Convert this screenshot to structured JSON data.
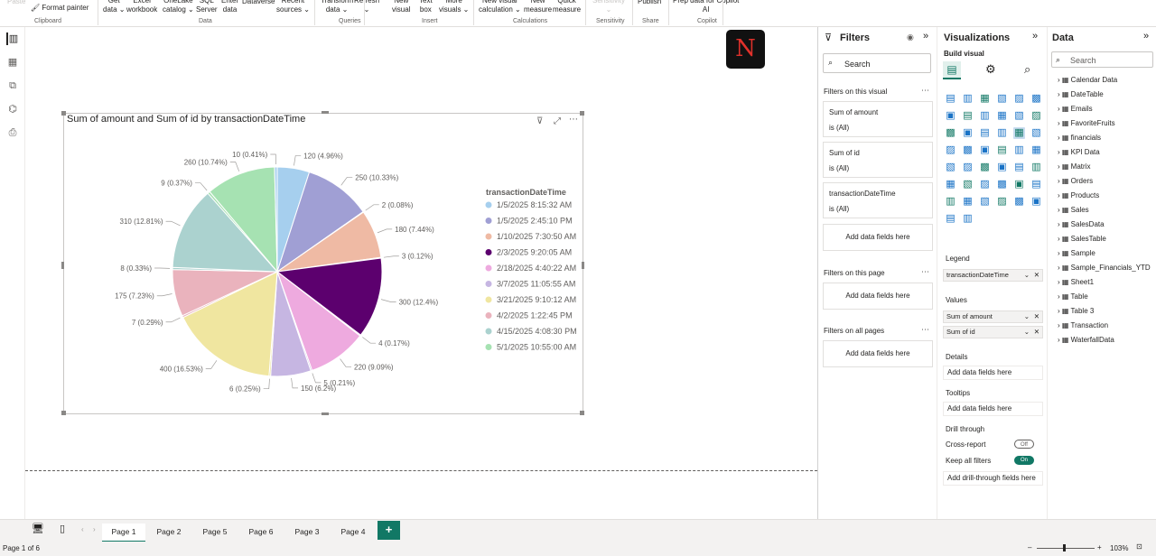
{
  "ribbon": {
    "format_painter": "Format painter",
    "buttons": [
      {
        "l1": "Paste",
        "l2": "",
        "x": 8
      },
      {
        "l1": "Get",
        "l2": "data ⌄",
        "x": 114
      },
      {
        "l1": "Excel",
        "l2": "workbook",
        "x": 140
      },
      {
        "l1": "OneLake",
        "l2": "catalog ⌄",
        "x": 180
      },
      {
        "l1": "SQL",
        "l2": "Server",
        "x": 217
      },
      {
        "l1": "Enter",
        "l2": "data",
        "x": 245
      },
      {
        "l1": "Dataverse",
        "l2": "",
        "x": 268
      },
      {
        "l1": "Recent",
        "l2": "sources ⌄",
        "x": 306
      },
      {
        "l1": "Transform",
        "l2": "data ⌄",
        "x": 355
      },
      {
        "l1": "Refresh",
        "l2": "⌄",
        "x": 392
      },
      {
        "l1": "New",
        "l2": "visual",
        "x": 434
      },
      {
        "l1": "Text",
        "l2": "box",
        "x": 464
      },
      {
        "l1": "More",
        "l2": "visuals ⌄",
        "x": 486
      },
      {
        "l1": "New visual",
        "l2": "calculation ⌄",
        "x": 530
      },
      {
        "l1": "New",
        "l2": "measure",
        "x": 580
      },
      {
        "l1": "Quick",
        "l2": "measure",
        "x": 612
      },
      {
        "l1": "Sensitivity",
        "l2": "⌄",
        "x": 656
      },
      {
        "l1": "Publish",
        "l2": "",
        "x": 706
      },
      {
        "l1": "Prep data for Copilot",
        "l2": "AI",
        "x": 745
      }
    ],
    "groups": [
      {
        "label": "Clipboard",
        "x": 38
      },
      {
        "label": "Data",
        "x": 220
      },
      {
        "label": "Queries",
        "x": 375
      },
      {
        "label": "Insert",
        "x": 467
      },
      {
        "label": "Calculations",
        "x": 568
      },
      {
        "label": "Sensitivity",
        "x": 660
      },
      {
        "label": "Share",
        "x": 711
      },
      {
        "label": "Copilot",
        "x": 772
      }
    ]
  },
  "visual": {
    "title": "Sum of amount and Sum of id by transactionDateTime",
    "legend_title": "transactionDateTime"
  },
  "chart_data": {
    "type": "pie",
    "title": "Sum of amount and Sum of id by transactionDateTime",
    "legend_title": "transactionDateTime",
    "slices": [
      {
        "label": "120 (4.96%)",
        "value": 120,
        "color": "#a6cfee",
        "series": "Sum of amount",
        "category": "1/5/2025 8:15:32 AM"
      },
      {
        "label": "250 (10.33%)",
        "value": 250,
        "color": "#a09fd4",
        "series": "Sum of amount",
        "category": "1/5/2025 2:45:10 PM"
      },
      {
        "label": "2 (0.08%)",
        "value": 2,
        "color": "#efb8a0",
        "series": "Sum of id",
        "category": "1/5/2025 2:45:10 PM"
      },
      {
        "label": "180 (7.44%)",
        "value": 180,
        "color": "#efbaa4",
        "series": "Sum of amount",
        "category": "1/10/2025 7:30:50 AM"
      },
      {
        "label": "3 (0.12%)",
        "value": 3,
        "color": "#5c006e",
        "series": "Sum of id",
        "category": "1/10/2025 7:30:50 AM"
      },
      {
        "label": "300 (12.4%)",
        "value": 300,
        "color": "#5c006e",
        "series": "Sum of amount",
        "category": "2/3/2025 9:20:05 AM"
      },
      {
        "label": "4 (0.17%)",
        "value": 4,
        "color": "#e8a6d6",
        "series": "Sum of id",
        "category": "2/3/2025 9:20:05 AM"
      },
      {
        "label": "220 (9.09%)",
        "value": 220,
        "color": "#eeaadf",
        "series": "Sum of amount",
        "category": "2/18/2025 4:40:22 AM"
      },
      {
        "label": "5 (0.21%)",
        "value": 5,
        "color": "#c3b4de",
        "series": "Sum of id",
        "category": "2/18/2025 4:40:22 AM"
      },
      {
        "label": "150 (6.2%)",
        "value": 150,
        "color": "#c6b6e2",
        "series": "Sum of amount",
        "category": "3/7/2025 11:05:55 AM"
      },
      {
        "label": "6 (0.25%)",
        "value": 6,
        "color": "#ebe39a",
        "series": "Sum of id",
        "category": "3/7/2025 11:05:55 AM"
      },
      {
        "label": "400 (16.53%)",
        "value": 400,
        "color": "#f0e6a0",
        "series": "Sum of amount",
        "category": "3/21/2025 9:10:12 AM"
      },
      {
        "label": "7 (0.29%)",
        "value": 7,
        "color": "#e8b0bc",
        "series": "Sum of id",
        "category": "3/21/2025 9:10:12 AM"
      },
      {
        "label": "175 (7.23%)",
        "value": 175,
        "color": "#eab3bd",
        "series": "Sum of amount",
        "category": "4/2/2025 1:22:45 PM"
      },
      {
        "label": "8 (0.33%)",
        "value": 8,
        "color": "#a8d0cc",
        "series": "Sum of id",
        "category": "4/2/2025 1:22:45 PM"
      },
      {
        "label": "310 (12.81%)",
        "value": 310,
        "color": "#abd2cf",
        "series": "Sum of amount",
        "category": "4/15/2025 4:08:30 PM"
      },
      {
        "label": "9 (0.37%)",
        "value": 9,
        "color": "#a5e0b0",
        "series": "Sum of id",
        "category": "4/15/2025 4:08:30 PM"
      },
      {
        "label": "260 (10.74%)",
        "value": 260,
        "color": "#a6e2b2",
        "series": "Sum of amount",
        "category": "5/1/2025 10:55:00 AM"
      },
      {
        "label": "10 (0.41%)",
        "value": 10,
        "color": "#a6cfee",
        "series": "Sum of id",
        "category": "5/1/2025 10:55:00 AM"
      }
    ],
    "legend": [
      {
        "label": "1/5/2025 8:15:32 AM",
        "color": "#a6cfee"
      },
      {
        "label": "1/5/2025 2:45:10 PM",
        "color": "#a09fd4"
      },
      {
        "label": "1/10/2025 7:30:50 AM",
        "color": "#efbaa4"
      },
      {
        "label": "2/3/2025 9:20:05 AM",
        "color": "#5c006e"
      },
      {
        "label": "2/18/2025 4:40:22 AM",
        "color": "#eeaadf"
      },
      {
        "label": "3/7/2025 11:05:55 AM",
        "color": "#c6b6e2"
      },
      {
        "label": "3/21/2025 9:10:12 AM",
        "color": "#f0e6a0"
      },
      {
        "label": "4/2/2025 1:22:45 PM",
        "color": "#eab3bd"
      },
      {
        "label": "4/15/2025 4:08:30 PM",
        "color": "#abd2cf"
      },
      {
        "label": "5/1/2025 10:55:00 AM",
        "color": "#a6e2b2"
      }
    ]
  },
  "filters": {
    "title": "Filters",
    "search_placeholder": "Search",
    "on_visual": "Filters on this visual",
    "cards": [
      {
        "name": "Sum of amount",
        "state": "is (All)"
      },
      {
        "name": "Sum of id",
        "state": "is (All)"
      },
      {
        "name": "transactionDateTime",
        "state": "is (All)"
      }
    ],
    "add_fields": "Add data fields here",
    "on_page": "Filters on this page",
    "on_all": "Filters on all pages"
  },
  "viz": {
    "title": "Visualizations",
    "build_visual": "Build visual",
    "legend_label": "Legend",
    "legend_field": "transactionDateTime",
    "values_label": "Values",
    "values_fields": [
      "Sum of amount",
      "Sum of id"
    ],
    "details_label": "Details",
    "tooltips_label": "Tooltips",
    "add_fields": "Add data fields here",
    "drill_label": "Drill through",
    "cross_report": "Cross-report",
    "cross_state": "Off",
    "keep_filters": "Keep all filters",
    "keep_state": "On",
    "add_drill": "Add drill-through fields here"
  },
  "data_pane": {
    "title": "Data",
    "search_placeholder": "Search",
    "tables": [
      "Calendar Data",
      "DateTable",
      "Emails",
      "FavoriteFruits",
      "financials",
      "KPI Data",
      "Matrix",
      "Orders",
      "Products",
      "Sales",
      "SalesData",
      "SalesTable",
      "Sample",
      "Sample_Financials_YTD",
      "Sheet1",
      "Table",
      "Table 3",
      "Transaction",
      "WaterfallData"
    ]
  },
  "tabs": {
    "pages": [
      "Page 1",
      "Page 2",
      "Page 5",
      "Page 6",
      "Page 3",
      "Page 4"
    ],
    "active": "Page 1",
    "add": "+"
  },
  "status": {
    "page": "Page 1 of 6",
    "zoom": "103%"
  },
  "colors": {
    "accent": "#117865",
    "canvas": "#ffffff"
  }
}
